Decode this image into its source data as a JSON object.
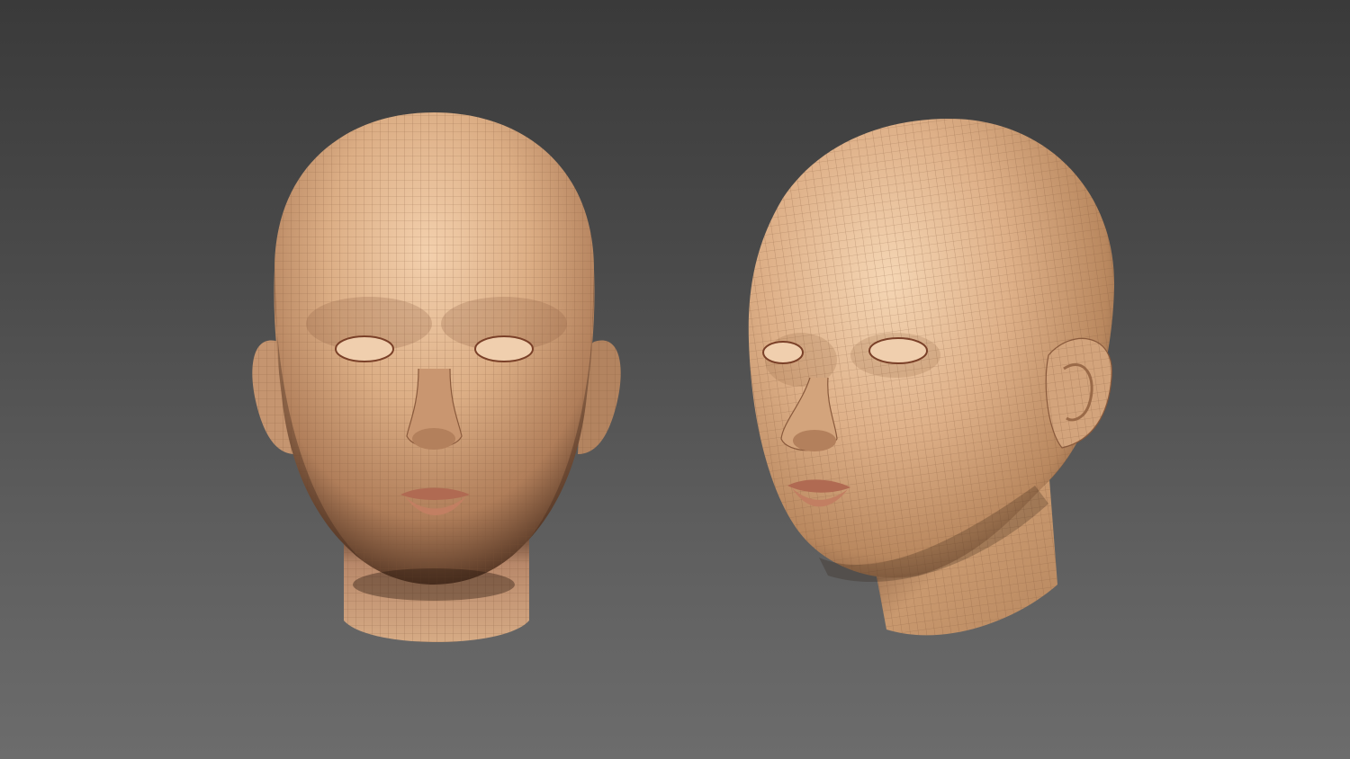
{
  "scene": {
    "background_top": "#3a3a3a",
    "background_bottom": "#6c6c6c",
    "skin_light": "#e9c19c",
    "skin_mid": "#c9976f",
    "skin_dark": "#6e4a33",
    "wire_color": "#7a5236"
  },
  "models": [
    {
      "view": "front",
      "icon": "head-mesh-front"
    },
    {
      "view": "three-quarter",
      "icon": "head-mesh-three-quarter"
    }
  ]
}
